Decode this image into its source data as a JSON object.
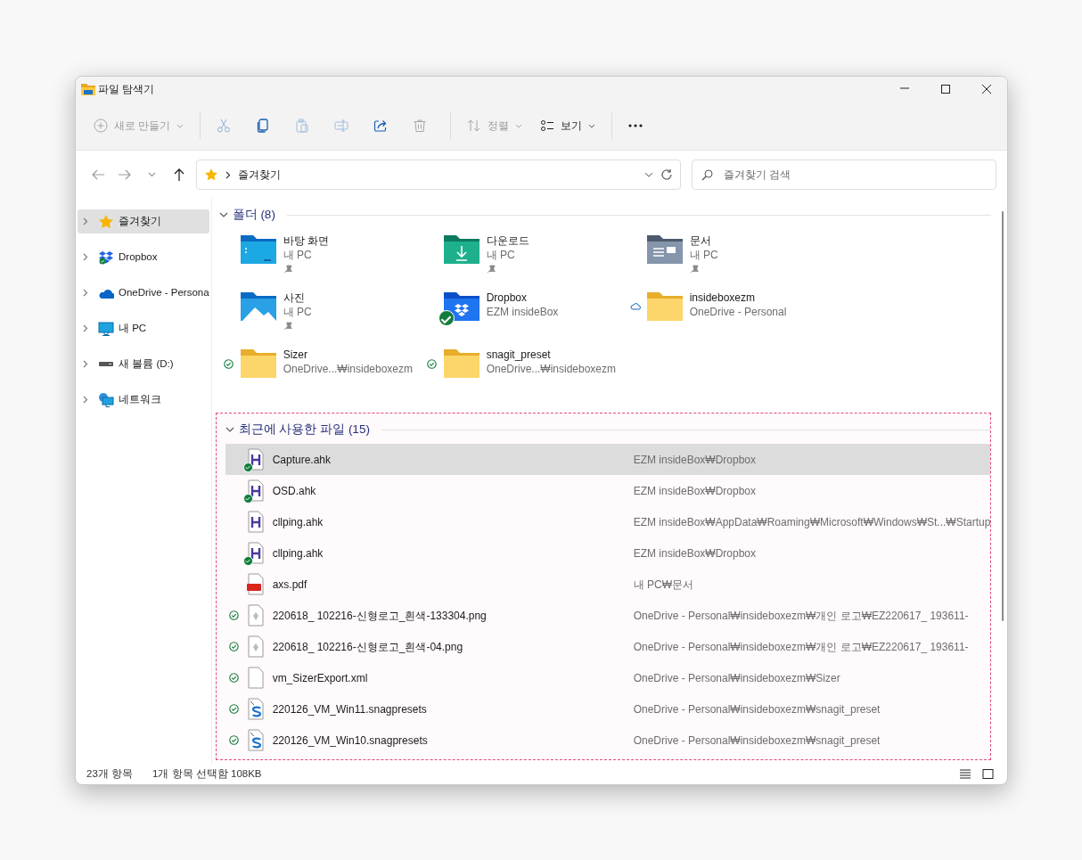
{
  "window": {
    "title": "파일 탐색기"
  },
  "toolbar": {
    "groups": [
      [
        {
          "kind": "new",
          "label": "새로 만들기",
          "disabled": true
        }
      ],
      [
        {
          "kind": "cut",
          "disabled": true
        },
        {
          "kind": "copy",
          "disabled": false
        },
        {
          "kind": "paste",
          "disabled": true
        },
        {
          "kind": "rename",
          "disabled": true
        },
        {
          "kind": "share",
          "disabled": false
        },
        {
          "kind": "delete",
          "disabled": true
        }
      ],
      [
        {
          "kind": "sort",
          "label": "정렬",
          "disabled": true
        },
        {
          "kind": "view",
          "label": "보기",
          "disabled": false
        }
      ],
      [
        {
          "kind": "more",
          "disabled": false
        }
      ]
    ]
  },
  "nav": [
    {
      "kind": "back",
      "disabled": true
    },
    {
      "kind": "forward",
      "disabled": true
    },
    {
      "kind": "recent",
      "disabled": true
    },
    {
      "kind": "up",
      "disabled": false
    }
  ],
  "address": {
    "path": "즐겨찾기"
  },
  "search": {
    "placeholder": "즐겨찾기 검색"
  },
  "sidebar": {
    "items": [
      {
        "label": "즐겨찾기",
        "kind": "star",
        "selected": true
      },
      {
        "label": "Dropbox",
        "kind": "dropbox",
        "selected": false
      },
      {
        "label": "OneDrive - Persona",
        "kind": "onedrive",
        "selected": false
      },
      {
        "label": "내 PC",
        "kind": "pc",
        "selected": false
      },
      {
        "label": "새 볼륨 (D:)",
        "kind": "drive",
        "selected": false
      },
      {
        "label": "네트워크",
        "kind": "network",
        "selected": false
      }
    ]
  },
  "folders": {
    "heading": "폴더 (8)",
    "expanded": true,
    "items": [
      {
        "name": "바탕 화면",
        "location": "내 PC",
        "kind": "desktop",
        "pinned": true
      },
      {
        "name": "다운로드",
        "location": "내 PC",
        "kind": "downloads",
        "pinned": true
      },
      {
        "name": "문서",
        "location": "내 PC",
        "kind": "documents",
        "pinned": true
      },
      {
        "name": "사진",
        "location": "내 PC",
        "kind": "pictures",
        "pinned": true
      },
      {
        "name": "Dropbox",
        "location": "EZM insideBox",
        "kind": "dropbox",
        "pinned": false,
        "synced": true
      },
      {
        "name": "insideboxezm",
        "location": "OneDrive - Personal",
        "kind": "plain",
        "pinned": false,
        "cloud": true
      },
      {
        "name": "Sizer",
        "location": "OneDrive...₩insideboxezm",
        "kind": "plain",
        "pinned": false,
        "synced": true
      },
      {
        "name": "snagit_preset",
        "location": "OneDrive...₩insideboxezm",
        "kind": "plain",
        "pinned": false,
        "synced": true
      }
    ]
  },
  "recent": {
    "heading": "최근에 사용한 파일 (15)",
    "expanded": true,
    "items": [
      {
        "name": "Capture.ahk",
        "location": "EZM insideBox₩Dropbox",
        "kind": "ahk",
        "synced": true,
        "selected": true
      },
      {
        "name": "OSD.ahk",
        "location": "EZM insideBox₩Dropbox",
        "kind": "ahk",
        "synced": true,
        "selected": false
      },
      {
        "name": "cllping.ahk",
        "location": "EZM insideBox₩AppData₩Roaming₩Microsoft₩Windows₩St...₩Startup",
        "kind": "ahk",
        "synced": false,
        "selected": false
      },
      {
        "name": "cllping.ahk",
        "location": "EZM insideBox₩Dropbox",
        "kind": "ahk",
        "synced": true,
        "selected": false
      },
      {
        "name": "axs.pdf",
        "location": "내 PC₩문서",
        "kind": "pdf",
        "synced": false,
        "selected": false
      },
      {
        "name": "220618_ 102216-신형로고_흰색-133304.png",
        "location": "OneDrive - Personal₩insideboxezm₩개인 로고₩EZ220617_ 193611-",
        "kind": "image",
        "synced": true,
        "selected": false
      },
      {
        "name": "220618_ 102216-신형로고_흰색-04.png",
        "location": "OneDrive - Personal₩insideboxezm₩개인 로고₩EZ220617_ 193611-",
        "kind": "image",
        "synced": true,
        "selected": false
      },
      {
        "name": "vm_SizerExport.xml",
        "location": "OneDrive - Personal₩insideboxezm₩Sizer",
        "kind": "blank",
        "synced": true,
        "selected": false
      },
      {
        "name": "220126_VM_Win11.snagpresets",
        "location": "OneDrive - Personal₩insideboxezm₩snagit_preset",
        "kind": "snagit",
        "synced": true,
        "selected": false
      },
      {
        "name": "220126_VM_Win10.snagpresets",
        "location": "OneDrive - Personal₩insideboxezm₩snagit_preset",
        "kind": "snagit",
        "synced": true,
        "selected": false
      }
    ]
  },
  "status_bar": {
    "count": "23개 항목",
    "selection": "1개 항목 선택함 108KB"
  },
  "view_buttons": [
    {
      "kind": "details"
    },
    {
      "kind": "tiles"
    }
  ]
}
